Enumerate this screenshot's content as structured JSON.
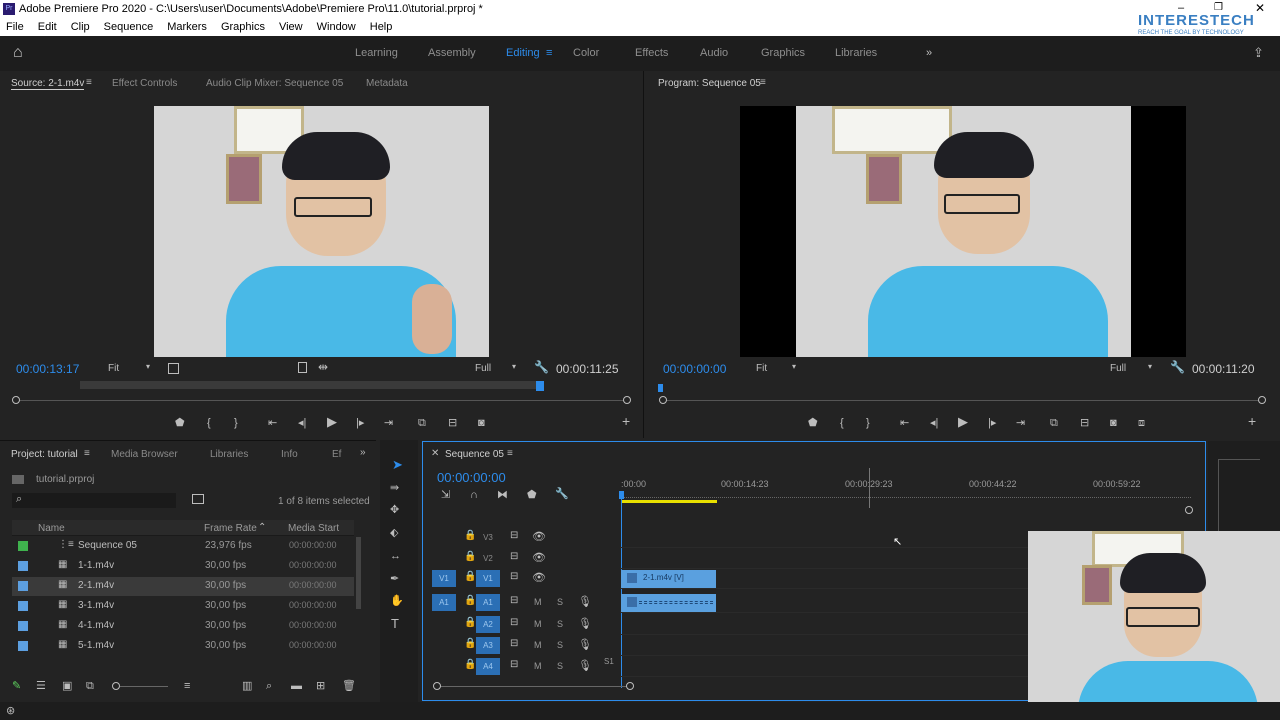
{
  "window": {
    "title": "Adobe Premiere Pro 2020 - C:\\Users\\user\\Documents\\Adobe\\Premiere Pro\\11.0\\tutorial.prproj *",
    "app_icon": "Pr"
  },
  "menu": [
    "File",
    "Edit",
    "Clip",
    "Sequence",
    "Markers",
    "Graphics",
    "View",
    "Window",
    "Help"
  ],
  "watermark": {
    "brand": "INTERESTECH",
    "tagline": "REACH THE GOAL BY TECHNOLOGY"
  },
  "workspaces": {
    "items": [
      "Learning",
      "Assembly",
      "Editing",
      "Color",
      "Effects",
      "Audio",
      "Graphics",
      "Libraries"
    ],
    "active": "Editing",
    "more": "»"
  },
  "source": {
    "tabs": [
      "Source: 2-1.m4v",
      "Effect Controls",
      "Audio Clip Mixer: Sequence 05",
      "Metadata"
    ],
    "timecode": "00:00:13:17",
    "fit": "Fit",
    "quality": "Full",
    "duration": "00:00:11:25"
  },
  "program": {
    "tab": "Program: Sequence 05",
    "timecode": "00:00:00:00",
    "fit": "Fit",
    "quality": "Full",
    "duration": "00:00:11:20"
  },
  "project": {
    "tabs": [
      "Project: tutorial",
      "Media Browser",
      "Libraries",
      "Info",
      "Ef"
    ],
    "file": "tutorial.prproj",
    "selected": "1 of 8 items selected",
    "columns": [
      "Name",
      "Frame Rate",
      "Media Start"
    ],
    "rows": [
      {
        "name": "Sequence 05",
        "rate": "23,976 fps",
        "start": "00:00:00:00",
        "color": "#3fb24d"
      },
      {
        "name": "1-1.m4v",
        "rate": "30,00 fps",
        "start": "00:00:00:00",
        "color": "#5d9fe0"
      },
      {
        "name": "2-1.m4v",
        "rate": "30,00 fps",
        "start": "00:00:00:00",
        "color": "#5d9fe0"
      },
      {
        "name": "3-1.m4v",
        "rate": "30,00 fps",
        "start": "00:00:00:00",
        "color": "#5d9fe0"
      },
      {
        "name": "4-1.m4v",
        "rate": "30,00 fps",
        "start": "00:00:00:00",
        "color": "#5d9fe0"
      },
      {
        "name": "5-1.m4v",
        "rate": "30,00 fps",
        "start": "00:00:00:00",
        "color": "#5d9fe0"
      }
    ]
  },
  "timeline": {
    "tab": "Sequence 05",
    "timecode": "00:00:00:00",
    "ruler": [
      ":00:00",
      "00:00:14:23",
      "00:00:29:23",
      "00:00:44:22",
      "00:00:59:22"
    ],
    "tracks": [
      {
        "name": "V3",
        "src": ""
      },
      {
        "name": "V2",
        "src": ""
      },
      {
        "name": "V1",
        "src": "V1"
      },
      {
        "name": "A1",
        "src": "A1"
      },
      {
        "name": "A2",
        "src": ""
      },
      {
        "name": "A3",
        "src": ""
      },
      {
        "name": "A4",
        "src": ""
      }
    ],
    "clip_video": "2-1.m4v [V]",
    "m_label": "M",
    "s_label": "S",
    "subtrack_label": "S1"
  },
  "colors": {
    "accent": "#2d8ceb",
    "clip": "#5aa0df",
    "work_area": "#e8e000"
  }
}
